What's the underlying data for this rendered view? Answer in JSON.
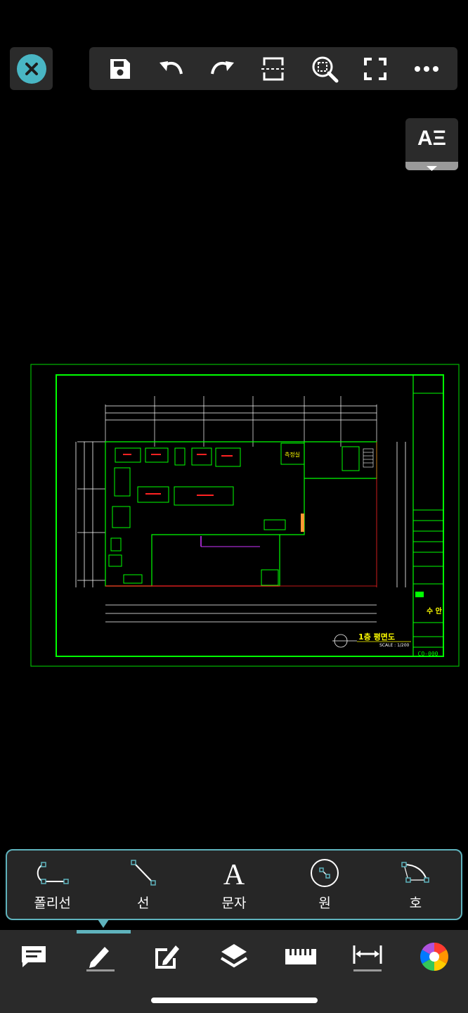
{
  "toolbar": {
    "icons": [
      "close-icon",
      "save-icon",
      "undo-icon",
      "redo-icon",
      "fit-width-icon",
      "zoom-area-icon",
      "fullscreen-icon",
      "more-icon"
    ]
  },
  "text_style": {
    "label": "AΞ"
  },
  "drawing": {
    "room_label": "측정실",
    "plan_title": "1층 평면도",
    "scale": "SCALE : 1/200",
    "drawing_number": "CO-000",
    "company": "수 안"
  },
  "draw_tools": [
    {
      "id": "polyline",
      "label": "폴리선",
      "icon": "polyline-icon"
    },
    {
      "id": "line",
      "label": "선",
      "icon": "line-icon"
    },
    {
      "id": "text",
      "label": "문자",
      "icon": "text-icon"
    },
    {
      "id": "circle",
      "label": "원",
      "icon": "circle-icon"
    },
    {
      "id": "arc",
      "label": "호",
      "icon": "arc-icon"
    }
  ],
  "bottom_tabs": [
    "comment-icon",
    "pen-icon",
    "edit-icon",
    "layers-icon",
    "ruler-icon",
    "dimension-icon",
    "color-wheel-icon"
  ],
  "colors": {
    "accent": "#5fb3bd",
    "cad_green": "#00ff00",
    "cad_red": "#ff2222",
    "cad_yellow": "#ffff00"
  }
}
